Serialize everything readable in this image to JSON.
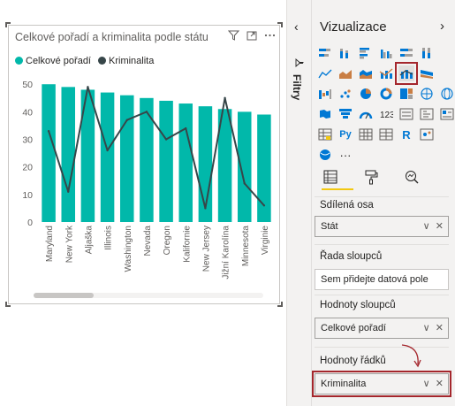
{
  "visual": {
    "title": "Celkové pořadí a kriminalita podle státu",
    "icons": [
      "filter-icon",
      "focus-mode-icon",
      "more-options-icon"
    ]
  },
  "chart_data": {
    "type": "bar",
    "categories": [
      "Maryland",
      "New York",
      "Aljaška",
      "Illinois",
      "Washington",
      "Nevada",
      "Oregon",
      "Kalifornie",
      "New Jersey",
      "Jižní Karolína",
      "Minnesota",
      "Virginie"
    ],
    "series": [
      {
        "name": "Celkové pořadí",
        "type": "bar",
        "color": "#01b8aa",
        "values": [
          50,
          49,
          48,
          47,
          46,
          45,
          44,
          43,
          42,
          41,
          40,
          39
        ]
      },
      {
        "name": "Kriminalita",
        "type": "line",
        "color": "#374649",
        "values": [
          33,
          11,
          49,
          26,
          37,
          40,
          30,
          34,
          5,
          45,
          14,
          6
        ]
      }
    ],
    "yticks": [
      0,
      10,
      20,
      30,
      40,
      50
    ],
    "ylim": [
      0,
      52
    ],
    "legend": "top-left",
    "grid": false
  },
  "filters": {
    "chevron": "‹",
    "label": "Filtry"
  },
  "pane": {
    "title": "Vizualizace",
    "chevron": "›",
    "tabs": [
      "fields-tab",
      "format-tab",
      "analytics-tab"
    ],
    "wells": [
      {
        "label": "Sdílená osa",
        "value": "Stát",
        "filled": true
      },
      {
        "label": "Řada sloupců",
        "value": "Sem přidejte datová pole",
        "filled": false
      },
      {
        "label": "Hodnoty sloupců",
        "value": "Celkové pořadí",
        "filled": true
      },
      {
        "label": "Hodnoty řádků",
        "value": "Kriminalita",
        "filled": true
      }
    ],
    "more": "···"
  },
  "colors": {
    "accent_selected": "#a4262c",
    "tab_underline": "#f2c811",
    "bar": "#01b8aa",
    "line": "#374649"
  }
}
